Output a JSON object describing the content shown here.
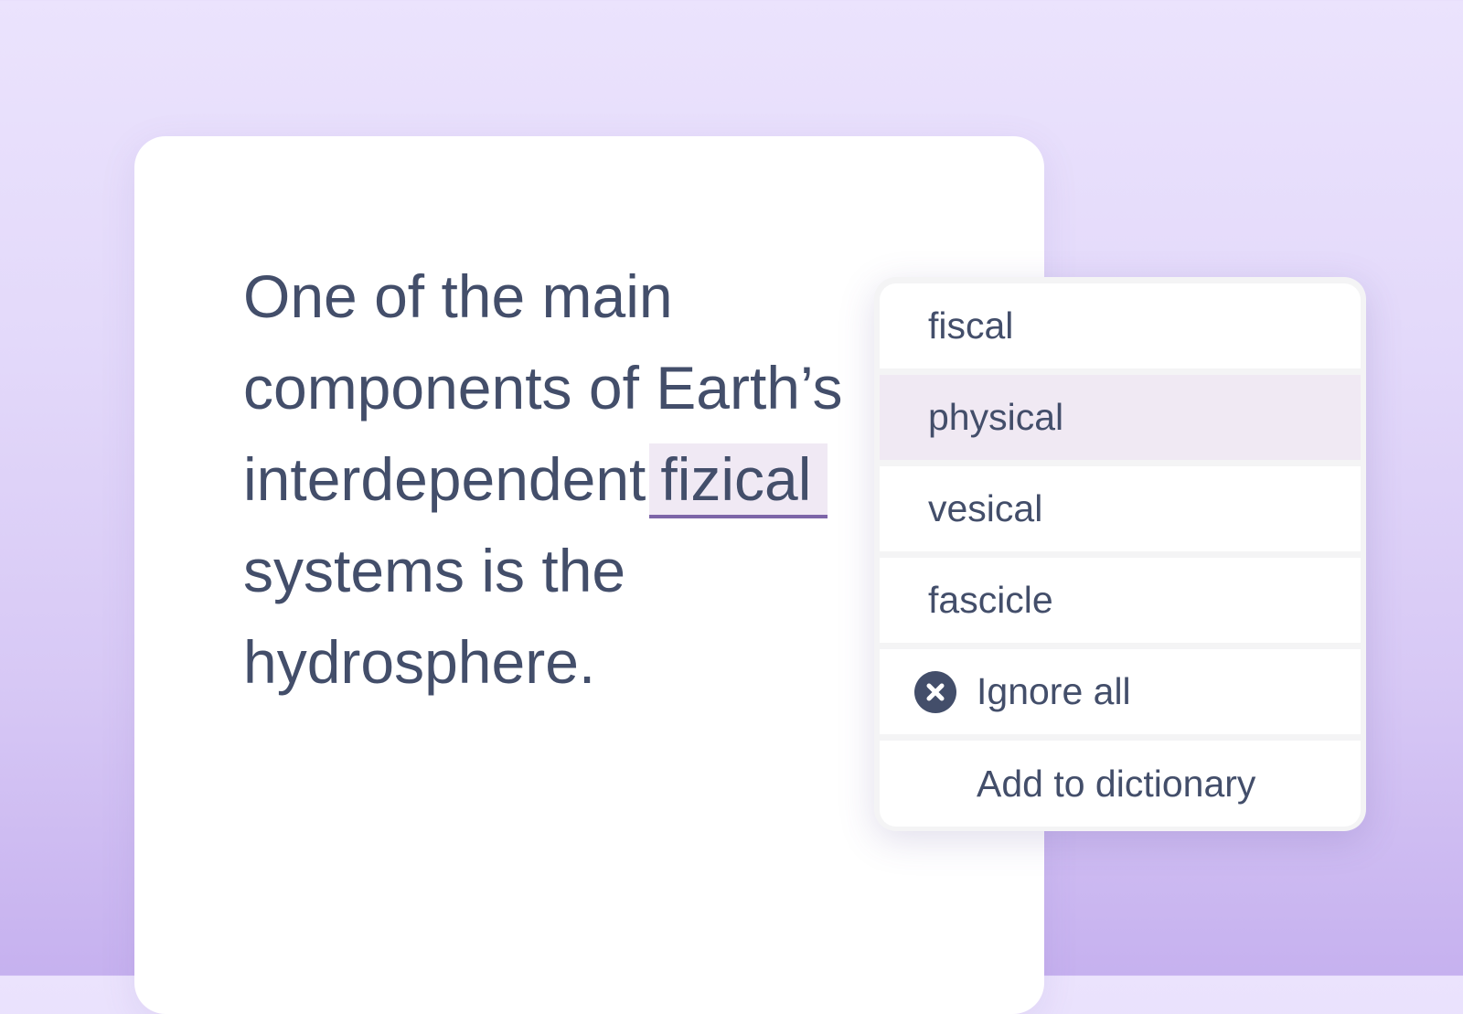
{
  "document": {
    "line1": "One of the main",
    "line2": "components of Earth’s",
    "line3_prefix": "interdependent",
    "misspelled_word": "fizical",
    "line4": "systems is the",
    "line5": "hydrosphere."
  },
  "suggestions_menu": {
    "suggestions": [
      "fiscal",
      "physical",
      "vesical",
      "fascicle"
    ],
    "highlighted_index": 1,
    "ignore_all_label": "Ignore all",
    "add_to_dictionary_label": "Add to dictionary",
    "icons": {
      "ignore_all": "close-circle-icon"
    }
  },
  "colors": {
    "text": "#434e6a",
    "misspelling_underline": "#7d65a8",
    "highlight_background": "#f0e9f3",
    "background_gradient_top": "#ebe3fd",
    "background_gradient_bottom": "#c6b1ef"
  }
}
